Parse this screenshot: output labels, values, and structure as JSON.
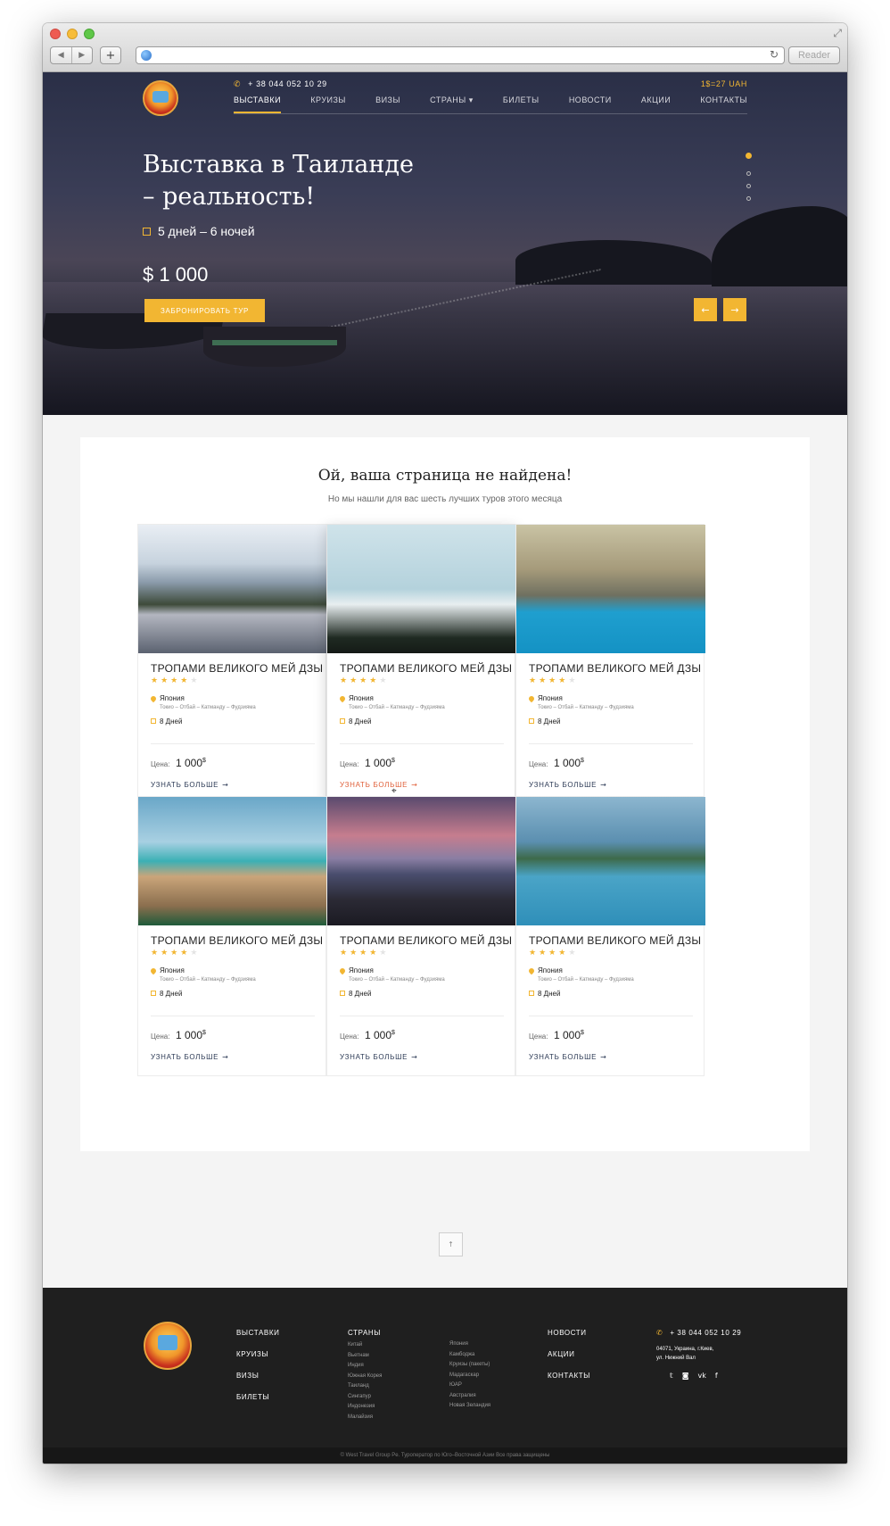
{
  "browser": {
    "reader_label": "Reader",
    "back_icon": "◀",
    "forward_icon": "▶",
    "plus_icon": "+",
    "reload_icon": "↻",
    "resize_icon": "⤢"
  },
  "header": {
    "phone": "+ 38 044 052 10 29",
    "phone_icon": "✆",
    "currency": "1$=27 UAH",
    "nav": [
      {
        "label": "ВЫСТАВКИ"
      },
      {
        "label": "КРУИЗЫ"
      },
      {
        "label": "ВИЗЫ"
      },
      {
        "label": "СТРАНЫ ▾"
      },
      {
        "label": "БИЛЕТЫ"
      },
      {
        "label": "НОВОСТИ"
      },
      {
        "label": "АКЦИИ"
      },
      {
        "label": "КОНТАКТЫ"
      }
    ],
    "active_nav": "ВЫСТАВКИ"
  },
  "hero": {
    "title": "Выставка в Таиланде\n– реальность!",
    "duration": "5 дней – 6 ночей",
    "price": "$ 1 000",
    "book_label": "ЗАБРОНИРОВАТЬ ТУР",
    "prev_icon": "←",
    "next_icon": "→",
    "slides_count": 4,
    "active_slide": 1
  },
  "section": {
    "title": "Ой, ваша страница не найдена!",
    "subtitle": "Но мы нашли для вас шесть лучших туров этого месяца"
  },
  "tours": [
    {
      "title": "ТРОПАМИ ВЕЛИКОГО МЕЙ ДЗЫ",
      "rating": 4,
      "country": "Япония",
      "route": "Токио – Отбай – Катманду – Фудзияма",
      "days": "8 Дней",
      "price_label": "Цена:",
      "price": "1 000",
      "currency_sup": "$",
      "more": "УЗНАТЬ БОЛЬШЕ",
      "image": "alpine-lake"
    },
    {
      "title": "ТРОПАМИ ВЕЛИКОГО МЕЙ ДЗЫ",
      "rating": 4,
      "country": "Япония",
      "route": "Токио – Отбай – Катманду – Фудзияма",
      "days": "8 Дней",
      "price_label": "Цена:",
      "price": "1 000",
      "currency_sup": "$",
      "more": "УЗНАТЬ БОЛЬШЕ",
      "image": "white-hotel"
    },
    {
      "title": "ТРОПАМИ ВЕЛИКОГО МЕЙ ДЗЫ",
      "rating": 4,
      "country": "Япония",
      "route": "Токио – Отбай – Катманду – Фудзияма",
      "days": "8 Дней",
      "price_label": "Цена:",
      "price": "1 000",
      "currency_sup": "$",
      "more": "УЗНАТЬ БОЛЬШЕ",
      "image": "courtyard-pool"
    },
    {
      "title": "ТРОПАМИ ВЕЛИКОГО МЕЙ ДЗЫ",
      "rating": 4,
      "country": "Япония",
      "route": "Токио – Отбай – Катманду – Фудзияма",
      "days": "8 Дней",
      "price_label": "Цена:",
      "price": "1 000",
      "currency_sup": "$",
      "more": "УЗНАТЬ БОЛЬШЕ",
      "image": "beach-deck"
    },
    {
      "title": "ТРОПАМИ ВЕЛИКОГО МЕЙ ДЗЫ",
      "rating": 4,
      "country": "Япония",
      "route": "Токио – Отбай – Катманду – Фудзияма",
      "days": "8 Дней",
      "price_label": "Цена:",
      "price": "1 000",
      "currency_sup": "$",
      "more": "УЗНАТЬ БОЛЬШЕ",
      "image": "sunset-pier"
    },
    {
      "title": "ТРОПАМИ ВЕЛИКОГО МЕЙ ДЗЫ",
      "rating": 4,
      "country": "Япония",
      "route": "Токио – Отбай – Катманду – Фудзияма",
      "days": "8 Дней",
      "price_label": "Цена:",
      "price": "1 000",
      "currency_sup": "$",
      "more": "УЗНАТЬ БОЛЬШЕ",
      "image": "infinity-pool"
    }
  ],
  "hovered_tour": 2,
  "to_top_icon": "↑",
  "footer": {
    "main_links": [
      "ВЫСТАВКИ",
      "КРУИЗЫ",
      "ВИЗЫ",
      "БИЛЕТЫ"
    ],
    "countries_title": "СТРАНЫ",
    "countries_col1": [
      "Китай",
      "Вьетнам",
      "Индия",
      "Южная Корея",
      "Таиланд",
      "Сингапур",
      "Индонезия",
      "Малайзия"
    ],
    "countries_col2": [
      "Япония",
      "Камбоджа",
      "Круизы (пакеты)",
      "Мадагаскар",
      "ЮАР",
      "Австралия",
      "Новая Зеландия"
    ],
    "news_links": [
      "НОВОСТИ",
      "АКЦИИ",
      "КОНТАКТЫ"
    ],
    "phone": "+ 38 044 052 10 29",
    "address": "04071, Украина, г.Киев,\nул. Нижний Вал",
    "socials": [
      "twitter-icon",
      "instagram-icon",
      "vk-icon",
      "facebook-icon"
    ],
    "social_glyphs": [
      "𝕥",
      "◙",
      "vk",
      "f"
    ],
    "copyright": "© West Travel Group Pe. Туроператор по Юго–Восточной Азии Все права защищены"
  },
  "colors": {
    "accent": "#f2b632",
    "link": "#2c3a55",
    "link_hover": "#e0603a",
    "footer_bg": "#1f1f1f"
  }
}
